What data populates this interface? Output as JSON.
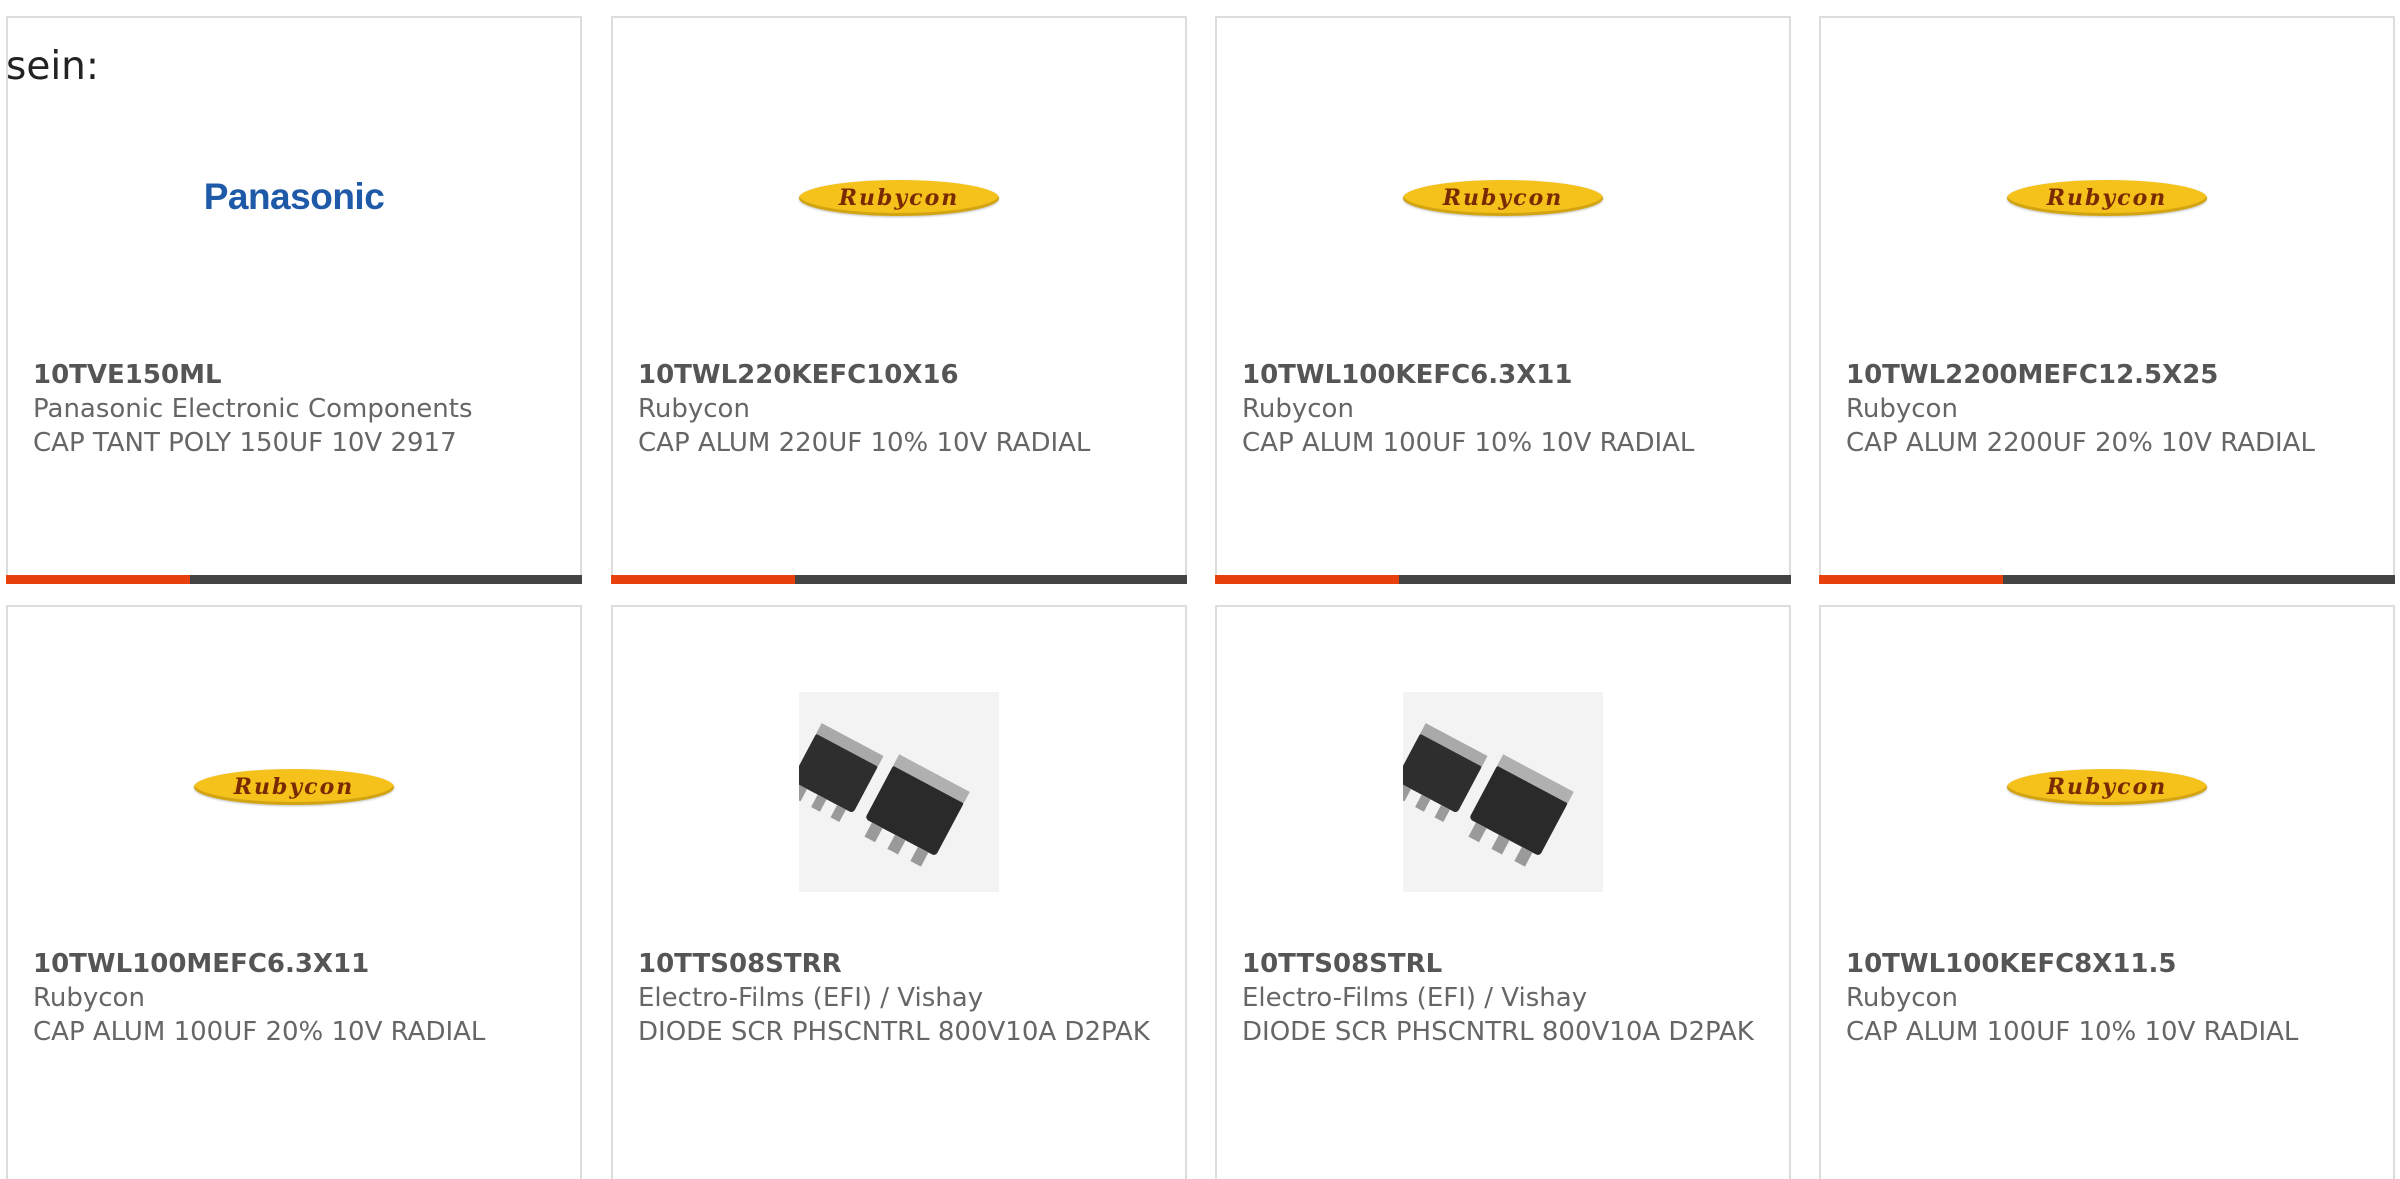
{
  "page": {
    "label": "sein:"
  },
  "colors": {
    "accent": "#e8400c",
    "bar": "#444444",
    "panasonic_blue": "#1e5aa8",
    "rubycon_yellow": "#f4c21b",
    "rubycon_text": "#7a2a00"
  },
  "cards": [
    {
      "part_number": "10TVE150ML",
      "manufacturer": "Panasonic Electronic Components",
      "description": "CAP TANT POLY 150UF 10V 2917",
      "image": "panasonic-logo",
      "logo_text": "Panasonic",
      "progress": 0.32
    },
    {
      "part_number": "10TWL220KEFC10X16",
      "manufacturer": "Rubycon",
      "description": "CAP ALUM 220UF 10% 10V RADIAL",
      "image": "rubycon-logo",
      "logo_text": "Rubycon",
      "progress": 0.32
    },
    {
      "part_number": "10TWL100KEFC6.3X11",
      "manufacturer": "Rubycon",
      "description": "CAP ALUM 100UF 10% 10V RADIAL",
      "image": "rubycon-logo",
      "logo_text": "Rubycon",
      "progress": 0.32
    },
    {
      "part_number": "10TWL2200MEFC12.5X25",
      "manufacturer": "Rubycon",
      "description": "CAP ALUM 2200UF 20% 10V RADIAL",
      "image": "rubycon-logo",
      "logo_text": "Rubycon",
      "progress": 0.32
    },
    {
      "part_number": "10TWL100MEFC6.3X11",
      "manufacturer": "Rubycon",
      "description": "CAP ALUM 100UF 20% 10V RADIAL",
      "image": "rubycon-logo",
      "logo_text": "Rubycon",
      "progress": null
    },
    {
      "part_number": "10TTS08STRR",
      "manufacturer": "Electro-Films (EFI) / Vishay",
      "description": "DIODE SCR PHSCNTRL 800V10A D2PAK",
      "image": "d2pak-package-photo",
      "progress": null
    },
    {
      "part_number": "10TTS08STRL",
      "manufacturer": "Electro-Films (EFI) / Vishay",
      "description": "DIODE SCR PHSCNTRL 800V10A D2PAK",
      "image": "d2pak-package-photo",
      "progress": null
    },
    {
      "part_number": "10TWL100KEFC8X11.5",
      "manufacturer": "Rubycon",
      "description": "CAP ALUM 100UF 10% 10V RADIAL",
      "image": "rubycon-logo",
      "logo_text": "Rubycon",
      "progress": null
    }
  ]
}
